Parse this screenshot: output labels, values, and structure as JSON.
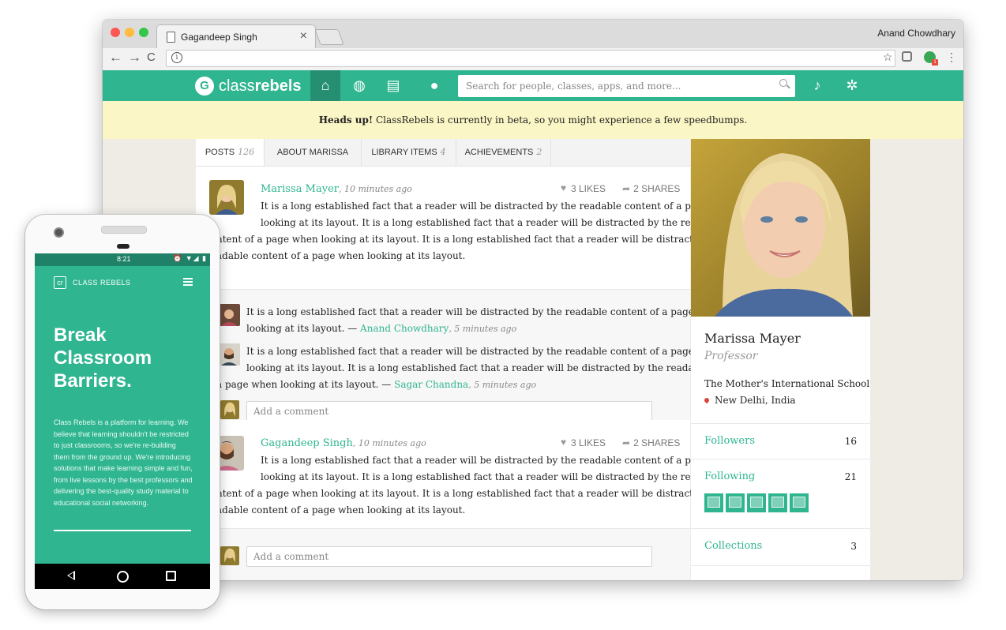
{
  "browser": {
    "tab_title": "Gagandeep Singh",
    "tab_close": "×",
    "profile_name": "Anand Chowdhary",
    "address": ""
  },
  "site": {
    "brand": {
      "prefix": "class",
      "suffix": "rebels"
    },
    "nav_icons": [
      "home-icon",
      "globe-icon",
      "book-icon",
      "user-icon"
    ],
    "search_placeholder": "Search for people, classes, apps, and more...",
    "beta_bold": "Heads up!",
    "beta_text": "ClassRebels is currently in beta, so you might experience a few speedbumps.",
    "accent_color": "#2fb590",
    "banner_color": "#fbf6c5"
  },
  "tabs": [
    {
      "label": "POSTS",
      "count": "126",
      "active": true
    },
    {
      "label": "ABOUT MARISSA",
      "count": ""
    },
    {
      "label": "LIBRARY ITEMS",
      "count": "4"
    },
    {
      "label": "ACHIEVEMENTS",
      "count": "2"
    }
  ],
  "posts": [
    {
      "author": "Marissa Mayer",
      "time": ", 10 minutes ago",
      "likes": "3 LIKES",
      "shares": "2 SHARES",
      "lines": [
        "It is a long established fact that a reader will be distracted by the readable content of a page when",
        "looking at its layout. It is a long established fact that a reader will be distracted by the readable",
        "ntent of a page when looking at its layout. It is a long established fact that a reader will be distracted by the",
        "adable content of a page when looking at its layout."
      ]
    },
    {
      "author": "Gagandeep Singh",
      "time": ", 10 minutes ago",
      "likes": "3 LIKES",
      "shares": "2 SHARES",
      "lines": [
        "It is a long established fact that a reader will be distracted by the readable content of a page when",
        "looking at its layout. It is a long established fact that a reader will be distracted by the readable",
        "ntent of a page when looking at its layout. It is a long established fact that a reader will be distracted by the",
        "adable content of a page when looking at its layout."
      ]
    }
  ],
  "comments": [
    {
      "line1": "It is a long established fact that a reader will be distracted by the readable content of a page when",
      "line2_pre": "looking at its layout. — ",
      "author": "Anand Chowdhary",
      "time": ", 5 minutes ago"
    },
    {
      "line1": "It is a long established fact that a reader will be distracted by the readable content of a page when",
      "line2": "looking at its layout. It is a long established fact that a reader will be distracted by the readable content",
      "line3_pre": "a page when looking at its layout. — ",
      "author": "Sagar Chandna",
      "time": ", 5 minutes ago"
    }
  ],
  "comment_placeholder": "Add a comment",
  "profile": {
    "name": "Marissa Mayer",
    "role": "Professor",
    "school": "The Mother's International School",
    "location": "New Delhi, India",
    "followers_label": "Followers",
    "followers_count": "16",
    "following_label": "Following",
    "following_count": "21",
    "collections_label": "Collections",
    "collections_count": "3"
  },
  "phone": {
    "time": "8:21",
    "status_icons": "⏰ ▼◢ ▮",
    "app_name": "CLASS REBELS",
    "hero_lines": [
      "Break",
      "Classroom",
      "Barriers."
    ],
    "description": "Class Rebels is a platform for learning. We believe that learning shouldn't be restricted to just classrooms, so we're re-building them from the ground up. We're introducing solutions that make learning simple and fun, from live lessons by the best professors and delivering the best-quality study material to educational social networking."
  }
}
